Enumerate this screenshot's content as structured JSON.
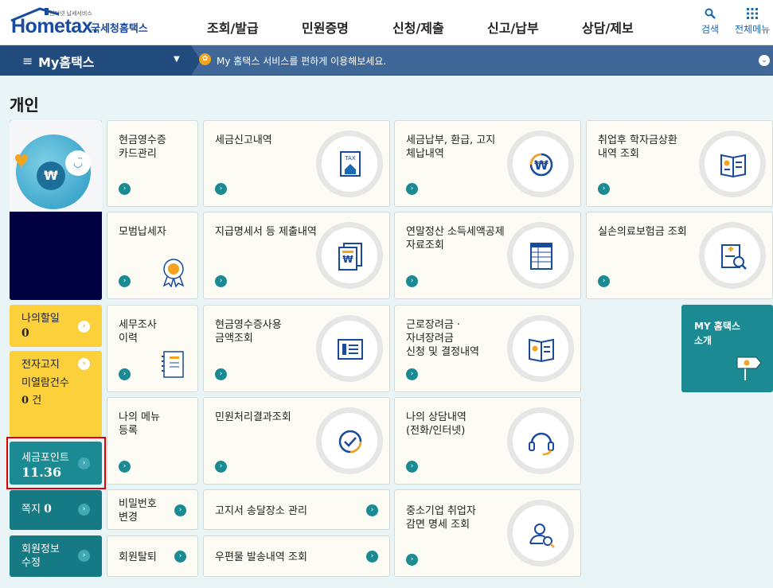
{
  "header": {
    "logo_text": "Hometax.",
    "logo_small": "인터넷 납세서비스",
    "logo_sub": "국세청홈택스",
    "menu": [
      "조회/발급",
      "민원증명",
      "신청/제출",
      "신고/납부",
      "상담/제보"
    ],
    "search_label": "검색",
    "all_menu_label": "전체메뉴"
  },
  "navbar": {
    "title": "My홈택스",
    "message": "My 홈택스 서비스를 편하게 이용해보세요."
  },
  "page_title": "개인",
  "side": {
    "todo_label": "나의할일",
    "todo_count": "0",
    "notice_label1": "전자고지",
    "notice_label2": "미열람건수",
    "notice_count": "0",
    "notice_unit": "건",
    "points_label": "세금포인트",
    "points_value": "11.36",
    "memo_label": "쪽지",
    "memo_count": "0",
    "member_label": "회원정보\n수정"
  },
  "cards": {
    "c1": "현금영수증\n카드관리",
    "c2": "세금신고내역",
    "c3": "세금납부, 환급, 고지\n체납내역",
    "c4": "취업후 학자금상환\n내역 조회",
    "c5": "모범납세자",
    "c6": "지급명세서 등 제출내역",
    "c7": "연말정산 소득세액공제\n자료조회",
    "c8": "실손의료보험금 조회",
    "c9": "세무조사\n이력",
    "c10": "현금영수증사용\n금액조회",
    "c11": "근로장려금 ·\n자녀장려금\n신청 및 결정내역",
    "c12": "나의 메뉴\n등록",
    "c13": "민원처리결과조회",
    "c14": "나의 상담내역\n(전화/인터넷)",
    "c15": "비밀번호\n변경",
    "c16": "고지서 송달장소 관리",
    "c17": "중소기업 취업자\n감면 명세 조회",
    "c18": "회원탈퇴",
    "c19": "우편물 발송내역 조회",
    "my_intro": "MY 홈택스\n소개"
  },
  "colors": {
    "teal": "#1b8a93",
    "yellow": "#fcd03a",
    "navy": "#214a7d",
    "brand": "#1a4a9e"
  }
}
